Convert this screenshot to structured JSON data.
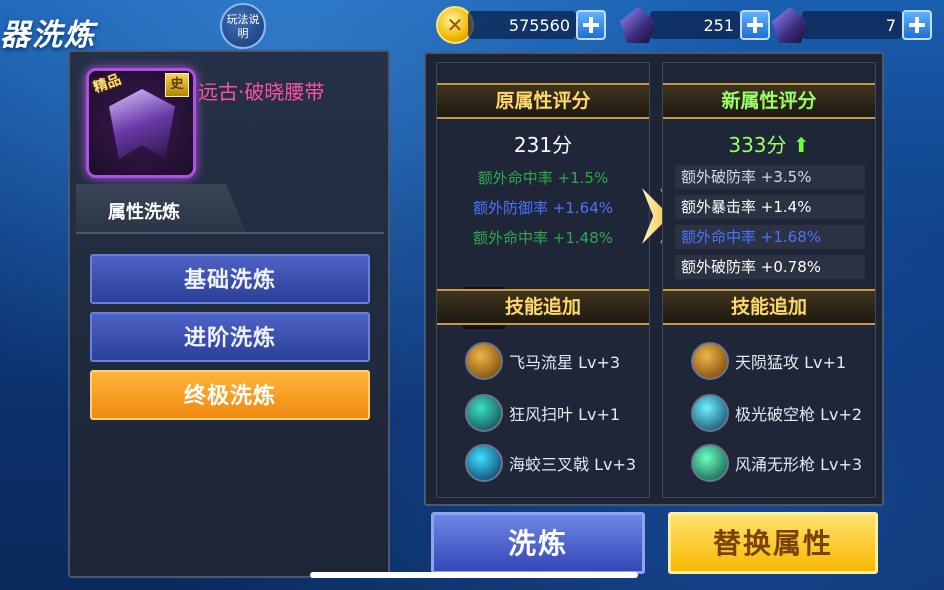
{
  "title": "器洗炼",
  "help_button": "玩法说明",
  "resources": {
    "gold": "575560",
    "gem_a": "251",
    "gem_b": "7"
  },
  "item": {
    "quality_tag": "精品",
    "rank_badge": "史",
    "name": "远古·破晓腰带"
  },
  "tab_label": "属性洗炼",
  "options": [
    "基础洗炼",
    "进阶洗炼",
    "终极洗炼"
  ],
  "original": {
    "header": "原属性评分",
    "score": "231分",
    "attrs": [
      {
        "text": "额外命中率 +1.5%",
        "color": "#2fa84a"
      },
      {
        "text": "额外防御率 +1.64%",
        "color": "#4a73ff"
      },
      {
        "text": "额外命中率 +1.48%",
        "color": "#2fa84a"
      }
    ],
    "skill_header": "技能追加",
    "skills": [
      {
        "name": "飞马流星 Lv+3",
        "icon": "pegasus-icon",
        "c1": "#f0b54a",
        "c2": "#6a3a00"
      },
      {
        "name": "狂风扫叶 Lv+1",
        "icon": "wind-icon",
        "c1": "#3ee0c0",
        "c2": "#0a3a4a"
      },
      {
        "name": "海蛟三叉戟 Lv+3",
        "icon": "trident-icon",
        "c1": "#3ee0ff",
        "c2": "#0a2a5a"
      }
    ]
  },
  "new": {
    "header": "新属性评分",
    "score": "333分",
    "attrs": [
      {
        "text": "额外破防率 +3.5%",
        "color": "#d8dbe6"
      },
      {
        "text": "额外暴击率 +1.4%",
        "color": "#ffffff"
      },
      {
        "text": "额外命中率 +1.68%",
        "color": "#4a73ff"
      },
      {
        "text": "额外破防率 +0.78%",
        "color": "#ffffff"
      }
    ],
    "skill_header": "技能追加",
    "skills": [
      {
        "name": "天陨猛攻 Lv+1",
        "icon": "meteor-icon",
        "c1": "#f0b54a",
        "c2": "#6a3a00"
      },
      {
        "name": "极光破空枪 Lv+2",
        "icon": "spear-icon",
        "c1": "#6ff0ff",
        "c2": "#0a3a5a"
      },
      {
        "name": "风涌无形枪 Lv+3",
        "icon": "wind-spear-icon",
        "c1": "#6affc0",
        "c2": "#0a4a3a"
      }
    ]
  },
  "buttons": {
    "refine": "洗炼",
    "replace": "替换属性"
  }
}
